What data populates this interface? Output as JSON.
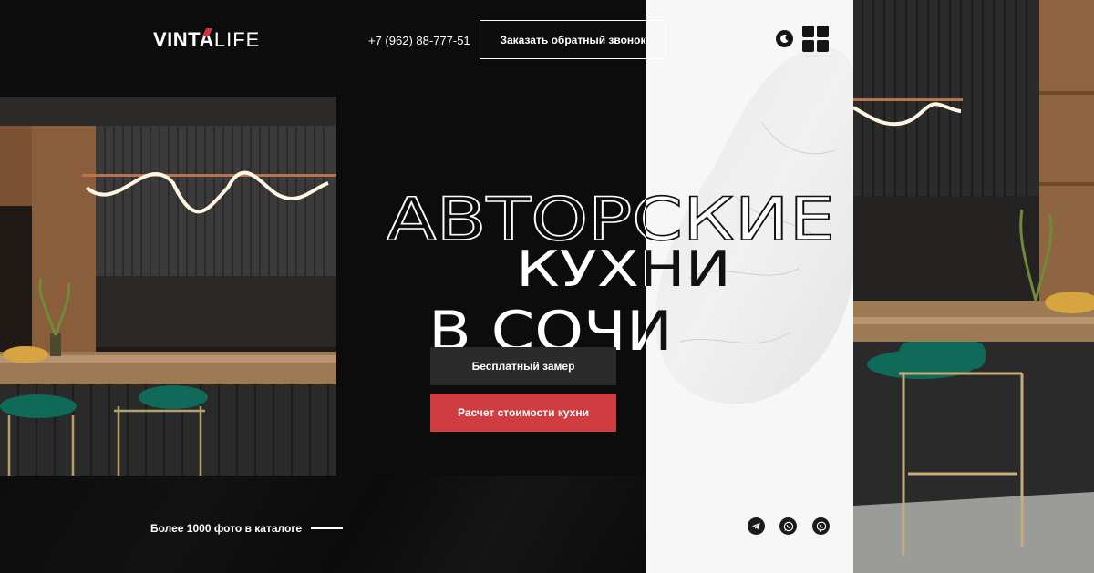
{
  "header": {
    "logo_bold": "VINTA",
    "logo_light": "LIFE",
    "phone": "+7 (962) 88-777-51",
    "callback_label": "Заказать обратный звонок"
  },
  "hero": {
    "line1": "АВТОРСКИЕ",
    "line2": "КУХНИ",
    "line3": "В СОЧИ",
    "btn_measure": "Бесплатный замер",
    "btn_calc": "Расчет стоимости кухни"
  },
  "footer": {
    "catalog_label": "Более 1000 фото в каталоге"
  },
  "icons": [
    "moon-icon",
    "menu-grid-icon",
    "telegram-icon",
    "whatsapp-icon",
    "viber-icon"
  ],
  "colors": {
    "accent": "#cf3d40",
    "dark": "#0c0c0c",
    "light": "#f7f7f7",
    "button_dark": "#2b2b2b"
  }
}
